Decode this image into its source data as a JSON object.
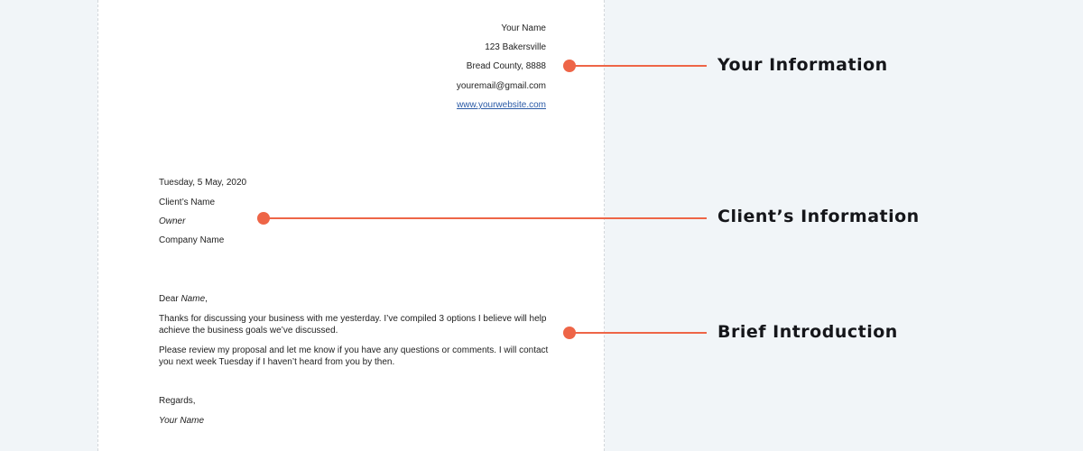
{
  "sender": {
    "name": "Your Name",
    "address_line1": "123 Bakersville",
    "address_line2": "Bread County, 8888",
    "email": "youremail@gmail.com",
    "website": "www.yourwebsite.com"
  },
  "recipient": {
    "date": "Tuesday, 5 May, 2020",
    "client_name": "Client’s Name",
    "title": "Owner",
    "company": "Company Name"
  },
  "body": {
    "salutation_prefix": "Dear ",
    "salutation_name": "Name",
    "salutation_suffix": ",",
    "paragraph1": "Thanks for discussing your business with me yesterday. I’ve compiled 3 options I believe will help achieve the business goals we’ve discussed.",
    "paragraph2": "Please review my proposal and let me know if you have any questions or comments. I will contact you next week Tuesday if I haven’t heard from you by then.",
    "closing": "Regards,",
    "signature": "Your Name"
  },
  "callouts": {
    "your_information": "Your Information",
    "clients_information": "Client’s Information",
    "brief_introduction": "Brief Introduction"
  },
  "colors": {
    "accent": "#ee6547",
    "background": "#f1f5f8",
    "page": "#ffffff"
  }
}
